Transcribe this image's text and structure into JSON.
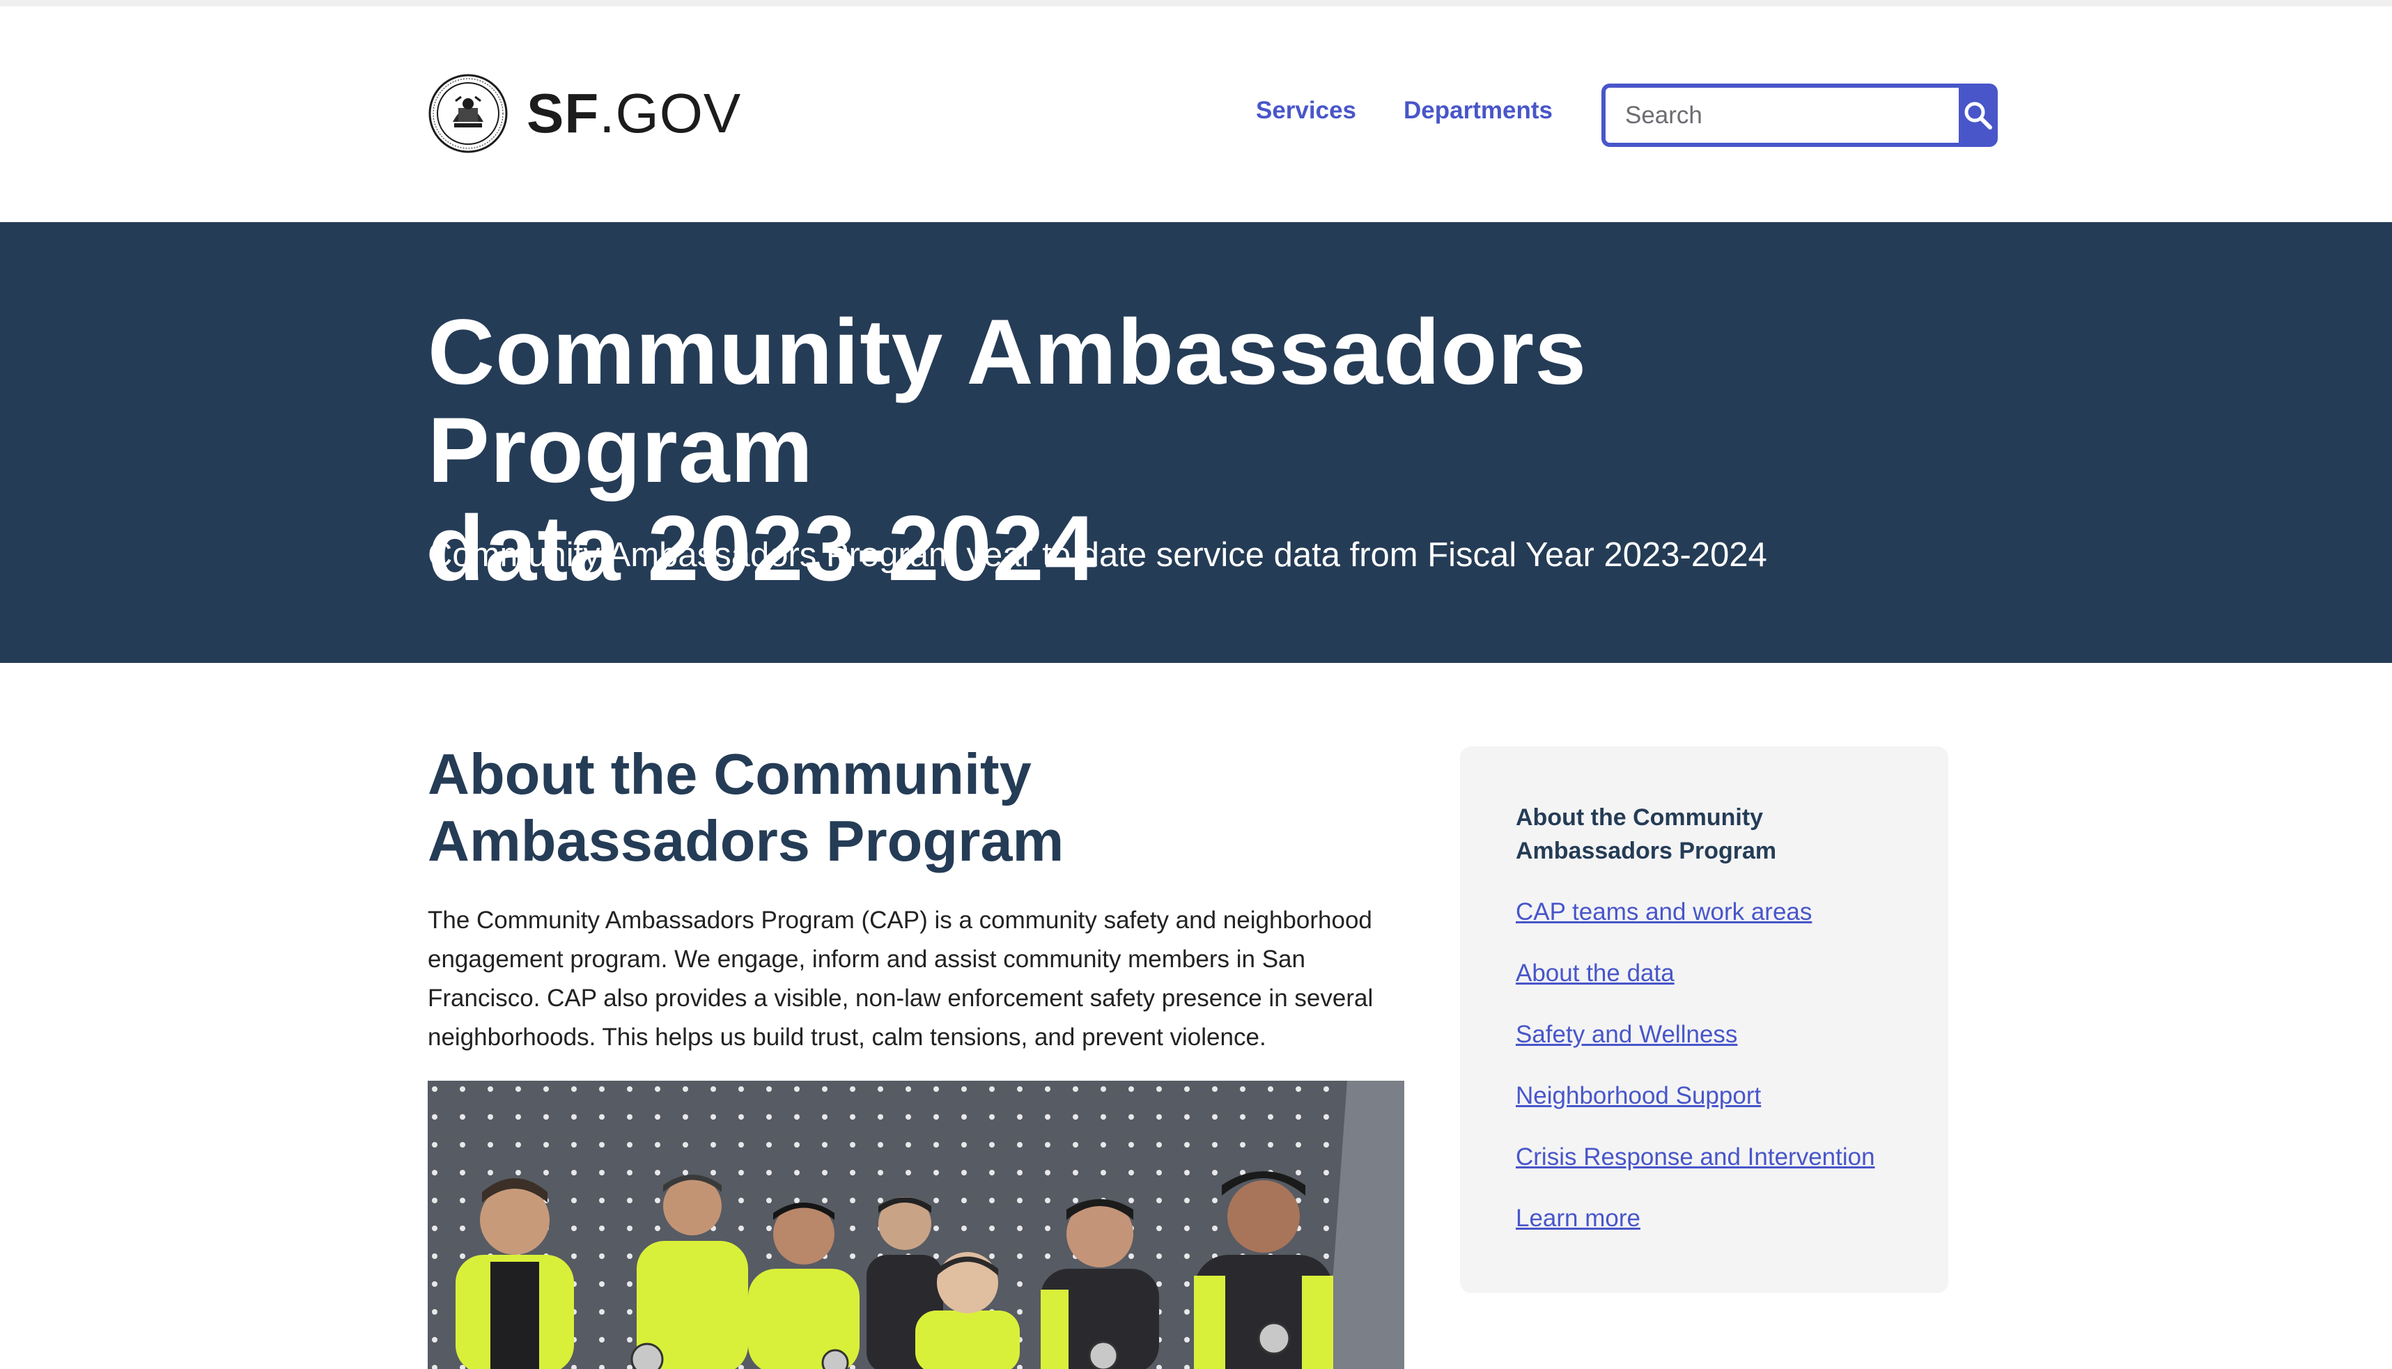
{
  "header": {
    "logo_text_bold": "SF",
    "logo_text_light": ".GOV",
    "nav": [
      {
        "label": "Services"
      },
      {
        "label": "Departments"
      }
    ],
    "search": {
      "placeholder": "Search",
      "button_icon": "search-icon"
    }
  },
  "hero": {
    "title_line1": "Community Ambassadors Program",
    "title_line2": "data 2023-2024",
    "subtitle": "Community Ambassadors Program year to date service data from Fiscal Year 2023-2024"
  },
  "main": {
    "heading_line1": "About the Community",
    "heading_line2": "Ambassadors Program",
    "intro": "The Community Ambassadors Program (CAP) is a community safety and neighborhood engagement program. We engage, inform and assist community members in San Francisco. CAP also provides a visible, non-law enforcement safety presence in several neighborhoods. This helps us build trust, calm tensions, and prevent violence."
  },
  "sidebar": {
    "current_line1": "About the Community",
    "current_line2": "Ambassadors Program",
    "links": [
      {
        "label": "CAP teams and work areas"
      },
      {
        "label": "About the data"
      },
      {
        "label": "Safety and Wellness"
      },
      {
        "label": "Neighborhood Support"
      },
      {
        "label": "Crisis Response and Intervention"
      },
      {
        "label": "Learn more"
      }
    ]
  },
  "colors": {
    "accent": "#4856c9",
    "hero_bg": "#253c56",
    "vest": "#d9f03a"
  }
}
